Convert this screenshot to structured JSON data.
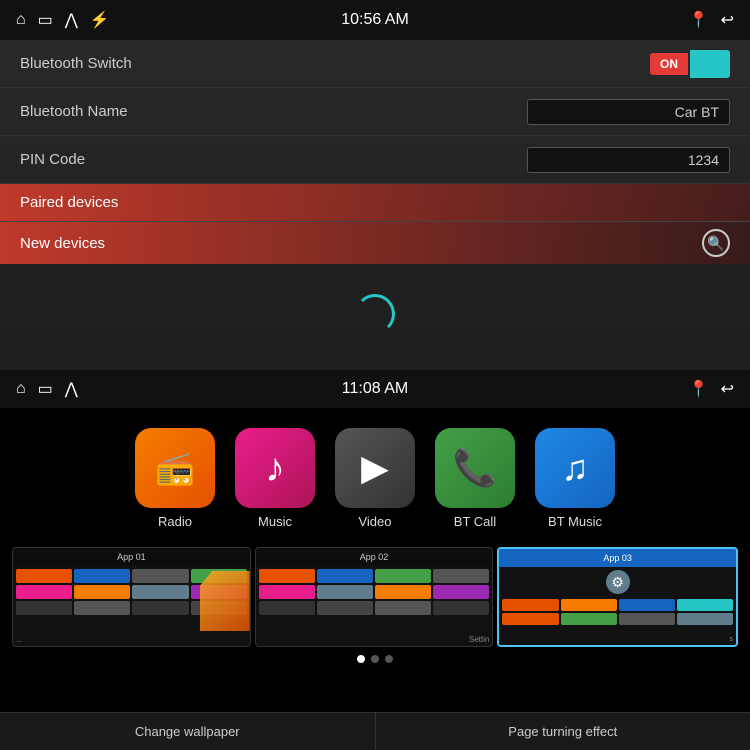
{
  "top_panel": {
    "status_bar": {
      "time": "10:56 AM",
      "left_icons": [
        "home",
        "screen",
        "chevron-up",
        "usb"
      ],
      "right_icons": [
        "location",
        "back"
      ]
    },
    "rows": [
      {
        "label": "Bluetooth Switch",
        "control_type": "toggle",
        "toggle_on_label": "ON"
      },
      {
        "label": "Bluetooth Name",
        "control_type": "input",
        "value": "Car BT"
      },
      {
        "label": "PIN Code",
        "control_type": "input",
        "value": "1234"
      }
    ],
    "sections": [
      {
        "label": "Paired devices"
      },
      {
        "label": "New devices"
      }
    ]
  },
  "bottom_panel": {
    "status_bar": {
      "time": "11:08 AM"
    },
    "apps": [
      {
        "label": "Radio",
        "class": "radio",
        "icon": "📻"
      },
      {
        "label": "Music",
        "class": "music",
        "icon": "♪"
      },
      {
        "label": "Video",
        "class": "video",
        "icon": "▶"
      },
      {
        "label": "BT Call",
        "class": "btcall",
        "icon": "📞"
      },
      {
        "label": "BT Music",
        "class": "btmusic",
        "icon": "♫"
      }
    ],
    "thumbnails": [
      {
        "title": "App 01",
        "active": false,
        "has_folder": true
      },
      {
        "title": "App 02",
        "active": false,
        "has_folder": false
      },
      {
        "title": "App 03",
        "active": true,
        "has_folder": false
      }
    ],
    "dots": [
      true,
      false,
      false
    ],
    "bottom_buttons": [
      "Change wallpaper",
      "Page turning effect"
    ]
  }
}
